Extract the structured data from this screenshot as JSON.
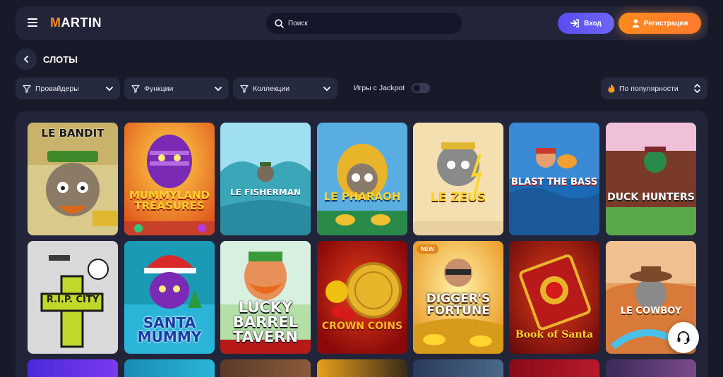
{
  "header": {
    "logo_letter": "M",
    "logo_rest": "ARTIN",
    "search_placeholder": "Поиск",
    "login_label": "Вход",
    "register_label": "Регистрация"
  },
  "page": {
    "title": "СЛОТЫ"
  },
  "filters": {
    "providers": "Провайдеры",
    "features": "Функции",
    "collections": "Коллекции",
    "jackpot_label": "Игры с Jackpot",
    "jackpot_on": false,
    "sort": "По популярности"
  },
  "games": [
    {
      "title": "LE BANDIT",
      "badge": ""
    },
    {
      "title": "MUMMYLAND TREASURES",
      "badge": ""
    },
    {
      "title": "LE FISHERMAN",
      "badge": ""
    },
    {
      "title": "LE PHARAOH",
      "badge": ""
    },
    {
      "title": "LE ZEUS",
      "badge": ""
    },
    {
      "title": "BLAST THE BASS",
      "badge": ""
    },
    {
      "title": "DUCK HUNTERS",
      "badge": ""
    },
    {
      "title": "R.I.P. CITY",
      "badge": ""
    },
    {
      "title": "SANTA MUMMY",
      "badge": ""
    },
    {
      "title": "LUCKY BARREL TAVERN",
      "badge": ""
    },
    {
      "title": "CROWN COINS",
      "badge": ""
    },
    {
      "title": "DIGGER'S FORTUNE",
      "badge": "NEW"
    },
    {
      "title": "Book of Santa",
      "badge": ""
    },
    {
      "title": "LE COWBOY",
      "badge": ""
    }
  ],
  "colors": {
    "background": "#181a2a",
    "panel": "#22253a",
    "accent_purple": "#5a4cf0",
    "accent_orange": "#ff8a1c"
  },
  "icons": {
    "menu": "burger-menu-icon",
    "search": "search-icon",
    "login": "login-arrow-icon",
    "register": "user-icon",
    "back": "chevron-left-icon",
    "filter": "funnel-icon",
    "dropdown": "chevron-down-icon",
    "sort_fire": "fire-icon",
    "sort_updown": "updown-icon",
    "support": "headset-icon"
  }
}
